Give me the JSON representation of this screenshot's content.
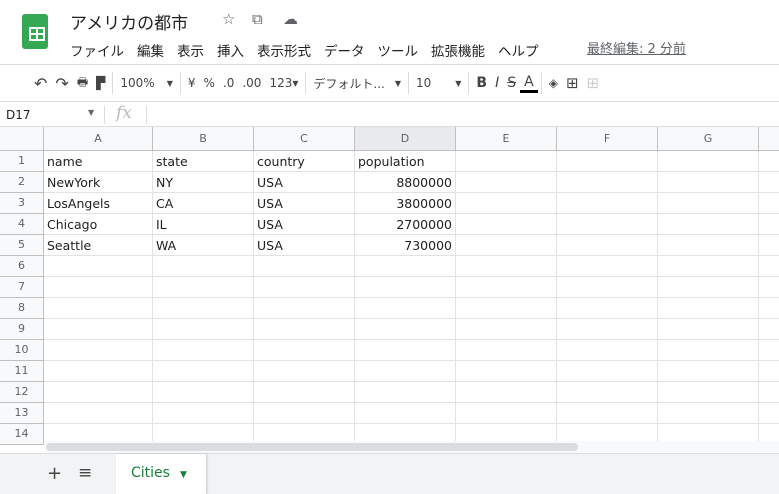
{
  "header": {
    "title": "アメリカの都市",
    "menu": [
      "ファイル",
      "編集",
      "表示",
      "挿入",
      "表示形式",
      "データ",
      "ツール",
      "拡張機能",
      "ヘルプ"
    ],
    "last_edit": "最終編集: 2 分前"
  },
  "toolbar": {
    "zoom": "100%",
    "currency": "¥",
    "percent": "%",
    "dec_less": ".0",
    "dec_more": ".00",
    "format": "123▾",
    "font": "デフォルト...",
    "size": "10",
    "bold": "B",
    "italic": "I",
    "strike": "S",
    "text_color": "A"
  },
  "formula": {
    "cell_ref": "D17",
    "fx": "fx",
    "value": ""
  },
  "columns": [
    "A",
    "B",
    "C",
    "D",
    "E",
    "F",
    "G"
  ],
  "rows": [
    [
      "name",
      "state",
      "country",
      "population"
    ],
    [
      "NewYork",
      "NY",
      "USA",
      "8800000"
    ],
    [
      "LosAngels",
      "CA",
      "USA",
      "3800000"
    ],
    [
      "Chicago",
      "IL",
      "USA",
      "2700000"
    ],
    [
      "Seattle",
      "WA",
      "USA",
      "730000"
    ]
  ],
  "row_count": 14,
  "sheets": {
    "active": "Cities",
    "add": "+",
    "list": "≡"
  }
}
